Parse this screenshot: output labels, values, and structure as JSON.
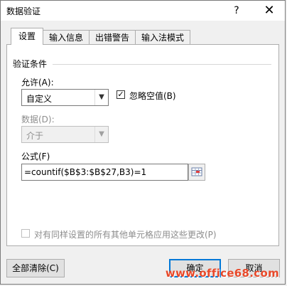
{
  "window": {
    "title": "数据验证",
    "help_label": "?",
    "close_label": "✕"
  },
  "tabs": [
    {
      "label": "设置",
      "active": true
    },
    {
      "label": "输入信息",
      "active": false
    },
    {
      "label": "出错警告",
      "active": false
    },
    {
      "label": "输入法模式",
      "active": false
    }
  ],
  "validation": {
    "section_title": "验证条件",
    "allow_label": "允许(A):",
    "allow_value": "自定义",
    "ignore_blank_label": "忽略空值(B)",
    "ignore_blank_checked": true,
    "data_label": "数据(D):",
    "data_value": "介于",
    "formula_label": "公式(F)",
    "formula_value": "=countif($B$3:$B$27,B3)=1"
  },
  "apply_all": {
    "label": "对有同样设置的所有其他单元格应用这些更改(P)",
    "checked": false
  },
  "buttons": {
    "clear_all": "全部清除(C)",
    "ok": "确定",
    "cancel": "取消"
  },
  "watermark": "www.office68.com",
  "colors": {
    "accent": "#0078d7",
    "watermark": "#e8492a"
  }
}
